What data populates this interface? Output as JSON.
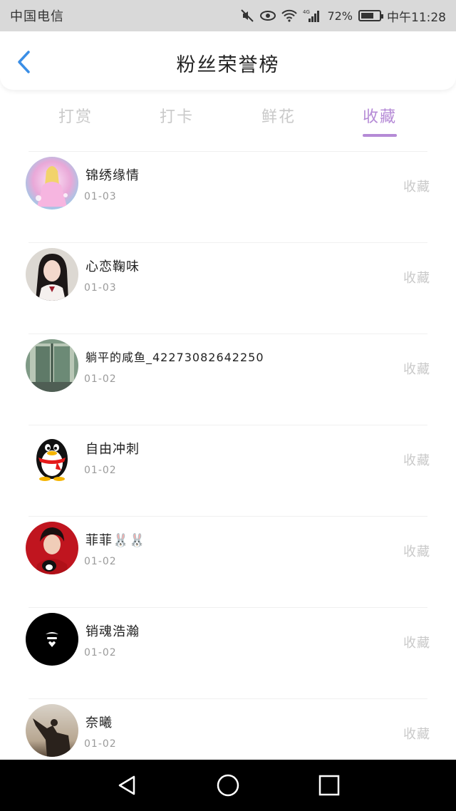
{
  "status_bar": {
    "carrier": "中国电信",
    "network": "4G",
    "battery": "72%",
    "battery_level": 0.72,
    "time": "中午11:28"
  },
  "header": {
    "title": "粉丝荣誉榜",
    "back_icon": "chevron-left-icon",
    "accent_color": "#3a8ee6"
  },
  "tabs": [
    {
      "label": "打赏",
      "active": false
    },
    {
      "label": "打卡",
      "active": false
    },
    {
      "label": "鲜花",
      "active": false
    },
    {
      "label": "收藏",
      "active": true
    }
  ],
  "tab_active_color": "#b58ad6",
  "list": {
    "items": [
      {
        "name": "锦绣缘情",
        "date": "01-03",
        "action": "收藏"
      },
      {
        "name": "心恋鞠味",
        "date": "01-03",
        "action": "收藏"
      },
      {
        "name": "躺平的咸鱼_42273082642250",
        "date": "01-02",
        "action": "收藏"
      },
      {
        "name": "自由冲刺",
        "date": "01-02",
        "action": "收藏"
      },
      {
        "name": "菲菲🐰🐰",
        "date": "01-02",
        "action": "收藏"
      },
      {
        "name": "销魂浩瀚",
        "date": "01-02",
        "action": "收藏"
      },
      {
        "name": "奈曦",
        "date": "01-02",
        "action": "收藏"
      }
    ]
  },
  "nav_bar": {
    "back": "triangle-back-icon",
    "home": "circle-home-icon",
    "recents": "square-recents-icon"
  }
}
